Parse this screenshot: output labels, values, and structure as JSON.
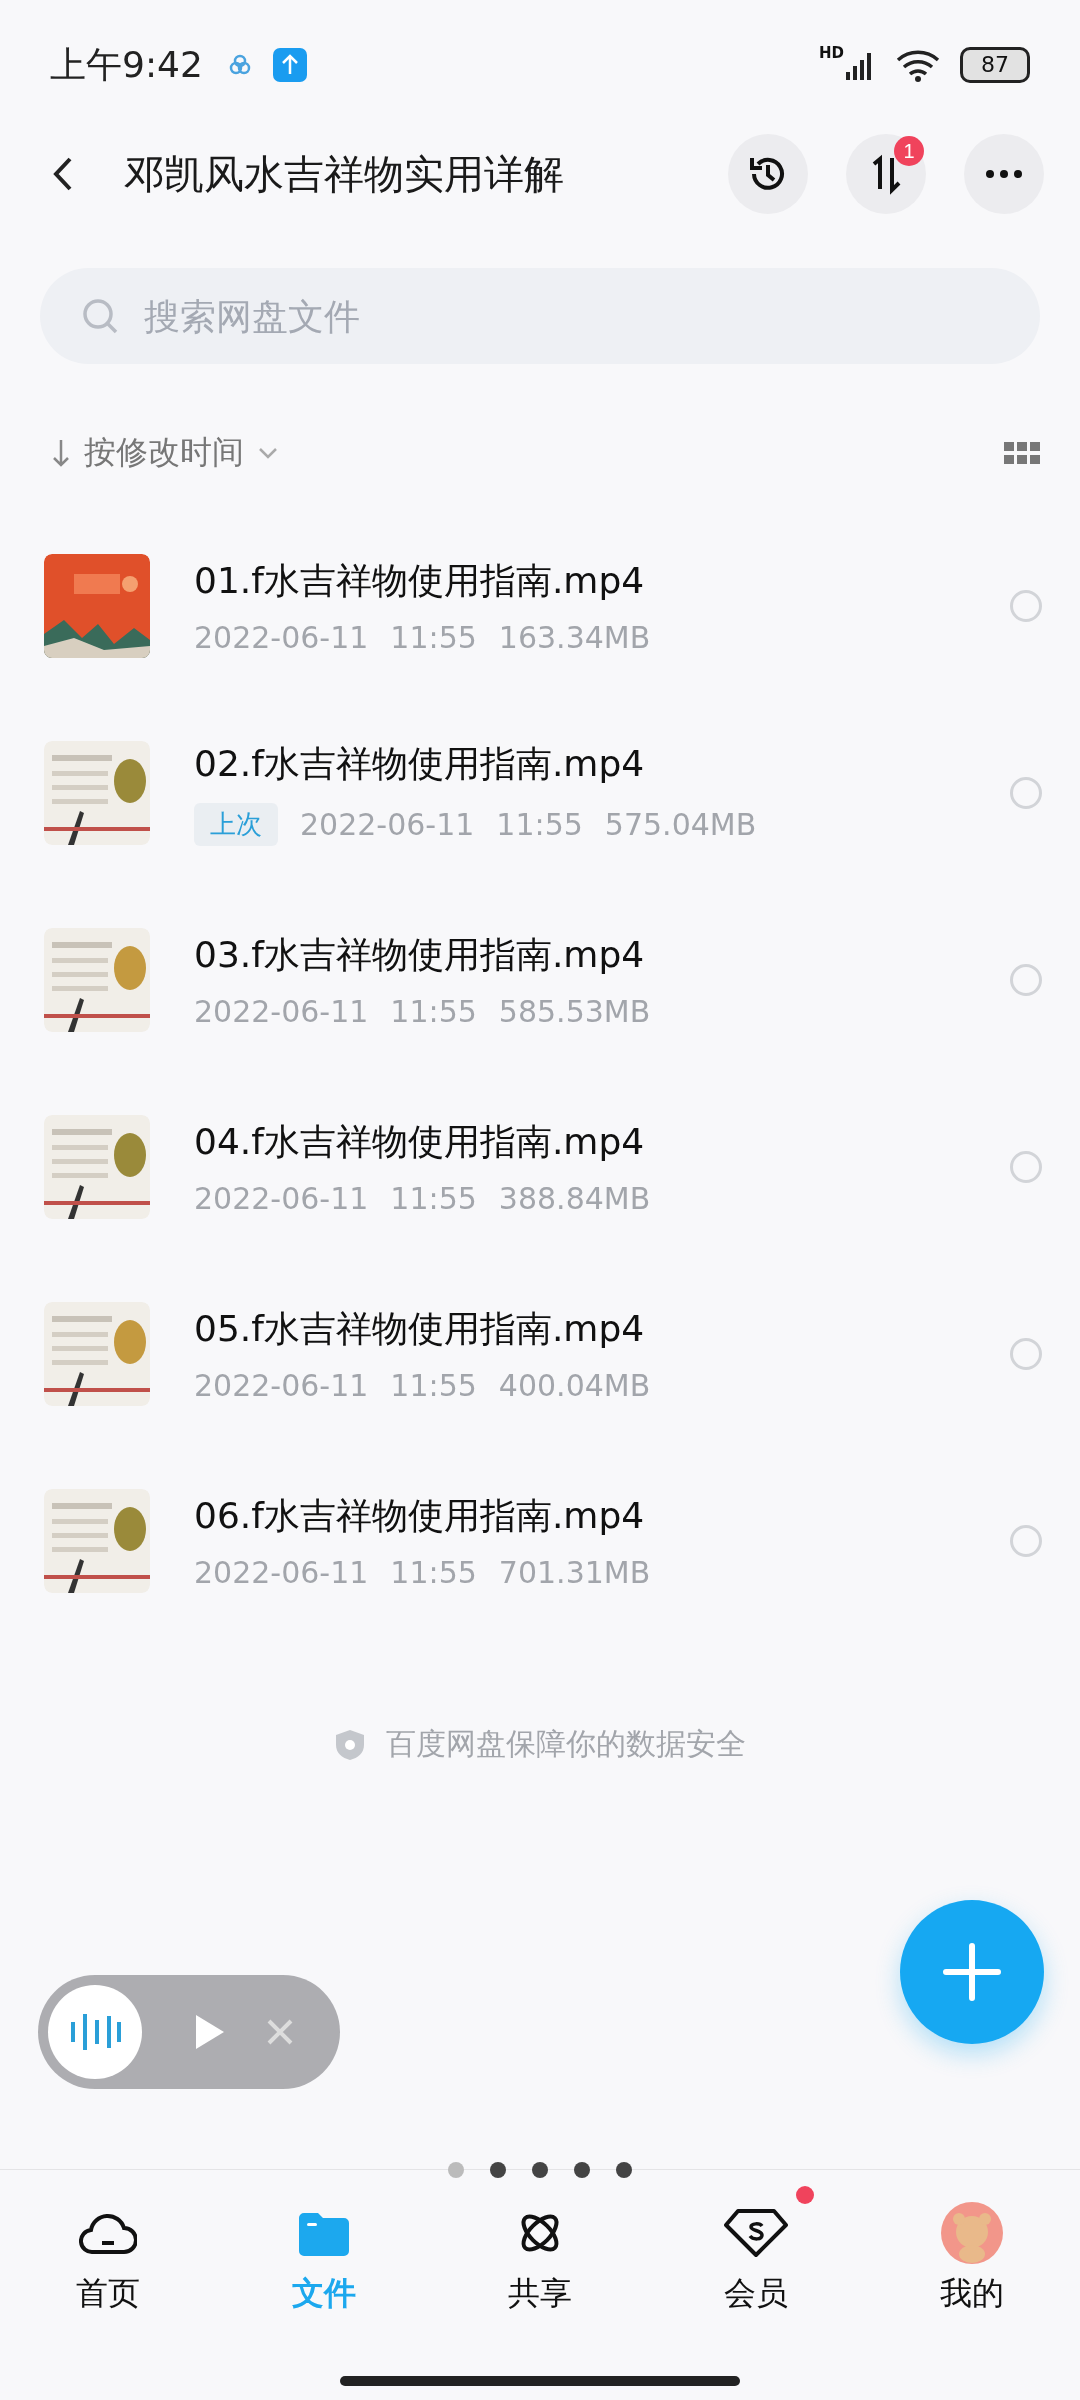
{
  "status_bar": {
    "time": "上午9:42",
    "network": "HD",
    "battery": "87"
  },
  "header": {
    "title": "邓凯风水吉祥物实用详解",
    "transfer_badge": "1"
  },
  "search": {
    "placeholder": "搜索网盘文件"
  },
  "sort": {
    "label": "按修改时间"
  },
  "files": [
    {
      "name": "01.f水吉祥物使用指南.mp4",
      "date": "2022-06-11",
      "time": "11:55",
      "size": "163.34MB",
      "selected": false
    },
    {
      "name": "02.f水吉祥物使用指南.mp4",
      "tag": "上次",
      "date": "2022-06-11",
      "time": "11:55",
      "size": "575.04MB",
      "selected": false
    },
    {
      "name": "03.f水吉祥物使用指南.mp4",
      "date": "2022-06-11",
      "time": "11:55",
      "size": "585.53MB",
      "selected": false
    },
    {
      "name": "04.f水吉祥物使用指南.mp4",
      "date": "2022-06-11",
      "time": "11:55",
      "size": "388.84MB",
      "selected": false
    },
    {
      "name": "05.f水吉祥物使用指南.mp4",
      "date": "2022-06-11",
      "time": "11:55",
      "size": "400.04MB",
      "selected": false
    },
    {
      "name": "06.f水吉祥物使用指南.mp4",
      "date": "2022-06-11",
      "time": "11:55",
      "size": "701.31MB",
      "selected": false
    }
  ],
  "footer_note": "百度网盘保障你的数据安全",
  "page_dots": [
    {
      "selected": true
    },
    {
      "selected": false
    },
    {
      "selected": false
    },
    {
      "selected": false
    },
    {
      "selected": false
    }
  ],
  "tabs": [
    {
      "kind": "home",
      "label": "首页",
      "selected": false,
      "dot": false
    },
    {
      "kind": "files",
      "label": "文件",
      "selected": true,
      "dot": false
    },
    {
      "kind": "share",
      "label": "共享",
      "selected": false,
      "dot": false
    },
    {
      "kind": "vip",
      "label": "会员",
      "selected": false,
      "dot": true
    },
    {
      "kind": "me",
      "label": "我的",
      "selected": false,
      "dot": false
    }
  ]
}
